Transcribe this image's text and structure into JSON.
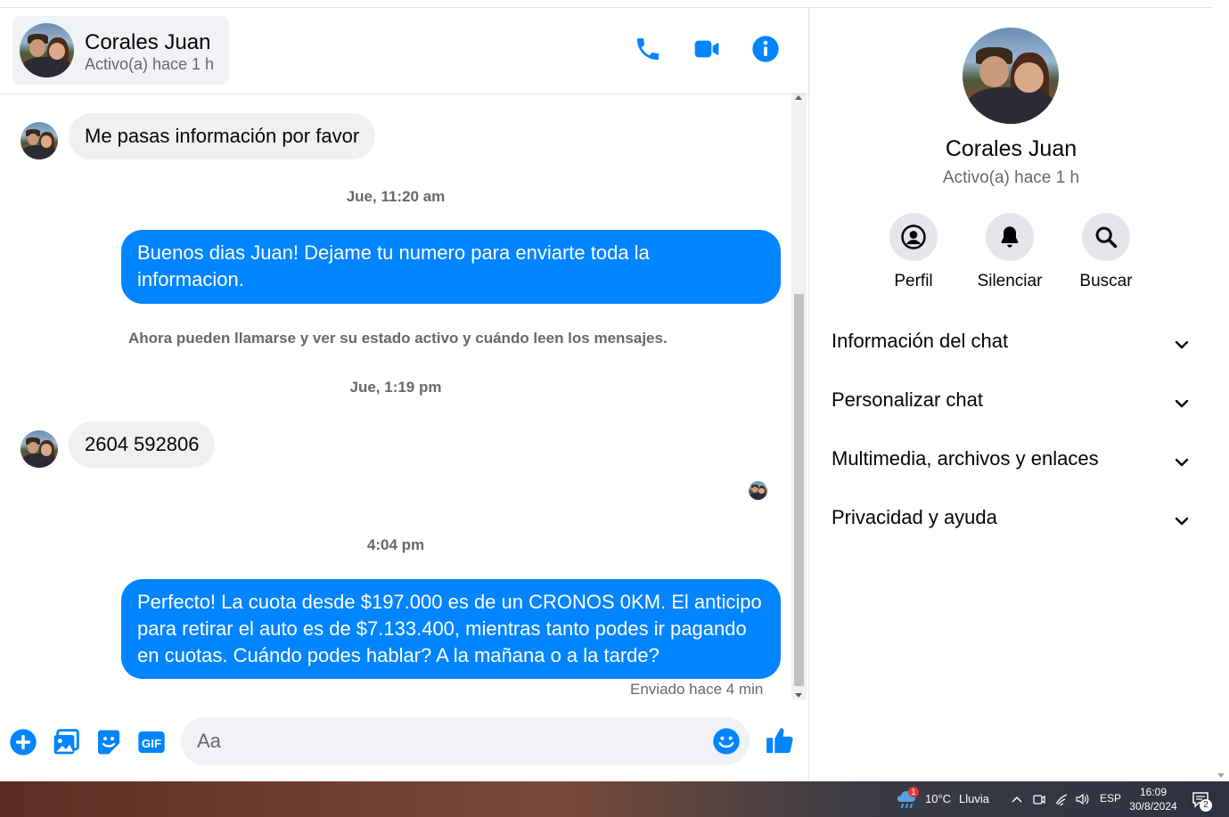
{
  "header": {
    "name": "Corales Juan",
    "status": "Activo(a) hace 1 h",
    "icons": [
      "phone-icon",
      "video-icon",
      "info-icon"
    ]
  },
  "messages": [
    {
      "type": "incoming",
      "text": "Me pasas información por favor"
    },
    {
      "type": "stamp",
      "text": "Jue, 11:20 am"
    },
    {
      "type": "outgoing",
      "lines": [
        "Buenos dias Juan! Dejame tu numero para enviarte toda la",
        "informacion."
      ]
    },
    {
      "type": "system",
      "text": "Ahora pueden llamarse y ver su estado activo y cuándo leen los mensajes."
    },
    {
      "type": "stamp",
      "text": "Jue, 1:19 pm"
    },
    {
      "type": "incoming",
      "text": "2604 592806"
    },
    {
      "type": "stamp",
      "text": "4:04 pm"
    },
    {
      "type": "outgoing",
      "lines": [
        "Perfecto! La cuota desde $197.000 es de un CRONOS 0KM. El anticipo",
        "para retirar el auto es de $7.133.400, mientras tanto podes ir pagando",
        "en cuotas. Cuándo podes hablar? A la mañana o a la tarde?"
      ]
    }
  ],
  "sent_status": "Enviado hace 4 min",
  "composer": {
    "placeholder": "Aa",
    "icons": [
      "plus-icon",
      "image-icon",
      "sticker-icon",
      "gif-icon",
      "emoji-icon",
      "like-icon"
    ],
    "gif_label": "GIF"
  },
  "sidebar": {
    "name": "Corales Juan",
    "status": "Activo(a) hace 1 h",
    "actions": [
      {
        "label": "Perfil",
        "icon": "profile-icon"
      },
      {
        "label": "Silenciar",
        "icon": "bell-icon"
      },
      {
        "label": "Buscar",
        "icon": "search-icon"
      }
    ],
    "sections": [
      {
        "label": "Información del chat"
      },
      {
        "label": "Personalizar chat"
      },
      {
        "label": "Multimedia, archivos y enlaces"
      },
      {
        "label": "Privacidad y ayuda"
      }
    ]
  },
  "taskbar": {
    "weather": "10°C",
    "weather_desc": "Lluvia",
    "weather_badge": "1",
    "lang": "ESP",
    "time": "16:09",
    "date": "30/8/2024",
    "notif_count": "2"
  },
  "colors": {
    "accent": "#0084ff",
    "incoming_bg": "#f0f0f0",
    "secondary_text": "#65676b"
  }
}
